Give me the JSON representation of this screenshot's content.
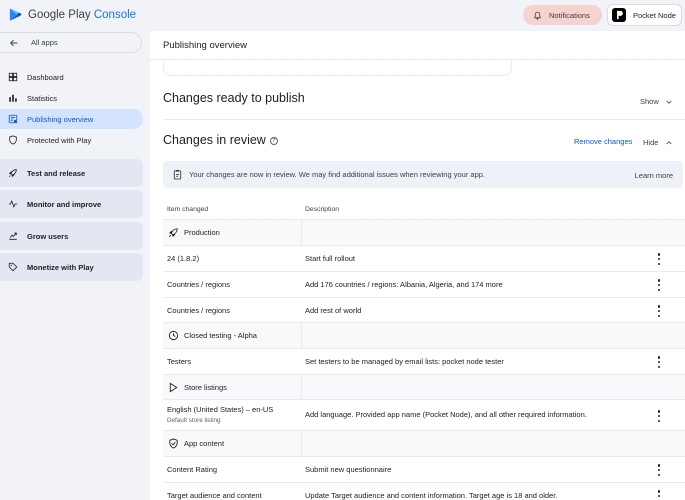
{
  "header": {
    "logo_text_1": "Google Play",
    "logo_text_2": "Console",
    "notifications_label": "Notifications",
    "account_name": "Pocket Node"
  },
  "sidebar": {
    "all_apps": "All apps",
    "items": [
      {
        "label": "Dashboard",
        "icon": "dashboard-icon"
      },
      {
        "label": "Statistics",
        "icon": "bar-chart-icon"
      },
      {
        "label": "Publishing overview",
        "icon": "publishing-icon",
        "active": true
      },
      {
        "label": "Protected with Play",
        "icon": "shield-icon"
      }
    ],
    "groups": [
      {
        "label": "Test and release",
        "icon": "rocket-icon"
      },
      {
        "label": "Monitor and improve",
        "icon": "pulse-icon"
      },
      {
        "label": "Grow users",
        "icon": "grow-icon"
      },
      {
        "label": "Monetize with Play",
        "icon": "tag-icon"
      }
    ]
  },
  "main": {
    "page_title": "Publishing overview",
    "ready_title": "Changes ready to publish",
    "show_label": "Show",
    "review_title": "Changes in review",
    "remove_changes": "Remove changes",
    "hide_label": "Hide",
    "banner_text": "Your changes are now in review. We may find additional issues when reviewing your app.",
    "learn_more": "Learn more",
    "columns": [
      "Item changed",
      "Description"
    ],
    "rows": [
      {
        "type": "group",
        "label": "Production",
        "icon": "rocket-icon"
      },
      {
        "type": "item",
        "item": "24 (1.8.2)",
        "desc": "Start full rollout"
      },
      {
        "type": "item",
        "item": "Countries / regions",
        "desc": "Add 176 countries / regions: Albania, Algeria, and 174 more"
      },
      {
        "type": "item",
        "item": "Countries / regions",
        "desc": "Add rest of world"
      },
      {
        "type": "group",
        "label": "Closed testing - Alpha",
        "icon": "closed-testing-icon"
      },
      {
        "type": "item",
        "item": "Testers",
        "desc": "Set testers to be managed by email lists: pocket node tester"
      },
      {
        "type": "group",
        "label": "Store listings",
        "icon": "play-store-icon"
      },
      {
        "type": "item",
        "item": "English (United States) – en-US",
        "sub": "Default store listing",
        "desc": "Add language. Provided app name (Pocket Node), and all other required information."
      },
      {
        "type": "group",
        "label": "App content",
        "icon": "shield-check-icon"
      },
      {
        "type": "item",
        "item": "Content Rating",
        "desc": "Submit new questionnaire"
      },
      {
        "type": "item",
        "item": "Target audience and content",
        "desc": "Update Target audience and content information. Target age is 18 and older."
      }
    ]
  },
  "colors": {
    "accent": "#1a73e8",
    "active_nav_bg": "#d3e3fd",
    "notification_bg": "#f6d3cf"
  }
}
